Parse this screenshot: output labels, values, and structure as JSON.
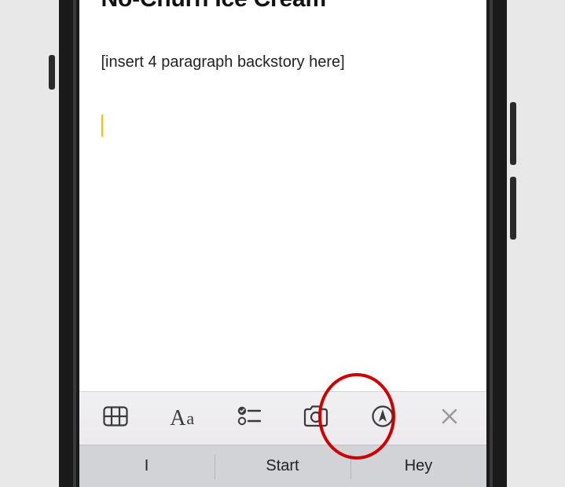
{
  "note": {
    "title": "No-Churn Ice Cream",
    "body_line_1": "[insert 4 paragraph backstory here]"
  },
  "toolbar": {
    "aa_label_cap": "A",
    "aa_label_low": "a"
  },
  "quicktype": {
    "suggestion_1": "I",
    "suggestion_2": "Start",
    "suggestion_3": "Hey"
  },
  "annotation": {
    "highlight_target": "camera-icon"
  }
}
